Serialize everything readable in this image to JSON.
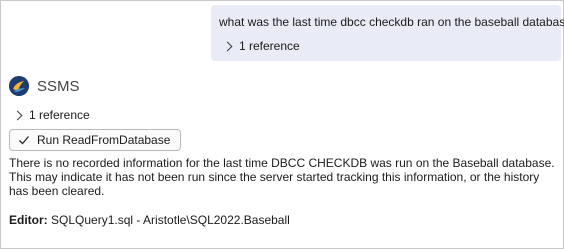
{
  "user_message": {
    "text": "what was the last time dbcc checkdb ran on the baseball database",
    "reference_label": "1 reference"
  },
  "assistant": {
    "name": "SSMS",
    "reference_label": "1 reference",
    "action_button_label": "Run ReadFromDatabase",
    "response_text": "There is no recorded information for the last time DBCC CHECKDB was run on the Baseball database. This may indicate it has not been run since the server started tracking this information, or the history has been cleared.",
    "editor_label": "Editor:",
    "editor_value": "SQLQuery1.sql - Aristotle\\SQL2022.Baseball"
  },
  "icons": {
    "logo": "ssms-logo-icon",
    "expand": "chevron-right-icon",
    "check": "checkmark-icon"
  },
  "colors": {
    "user_bubble_bg": "#e9ebf6",
    "logo_bg": "#1f3c6e"
  }
}
